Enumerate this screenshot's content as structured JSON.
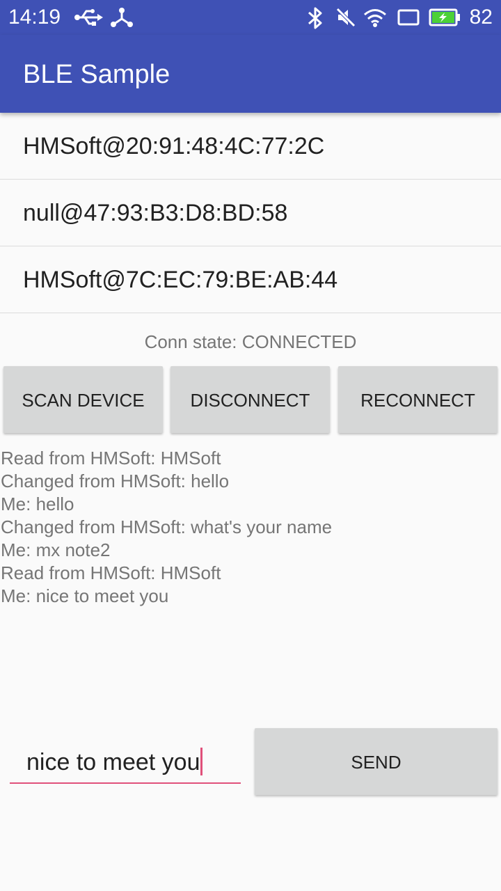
{
  "status_bar": {
    "time": "14:19",
    "battery_percent": "82",
    "icons": [
      "usb-icon",
      "share-icon",
      "bluetooth-icon",
      "mute-icon",
      "wifi-icon",
      "screen-icon",
      "battery-icon"
    ]
  },
  "app_bar": {
    "title": "BLE Sample"
  },
  "devices": [
    "HMSoft@20:91:48:4C:77:2C",
    "null@47:93:B3:D8:BD:58",
    "HMSoft@7C:EC:79:BE:AB:44"
  ],
  "conn_state": "Conn state: CONNECTED",
  "buttons": {
    "scan": "SCAN DEVICE",
    "disconnect": "DISCONNECT",
    "reconnect": "RECONNECT",
    "send": "SEND"
  },
  "log": [
    "Read from HMSoft: HMSoft",
    "Changed from HMSoft: hello",
    "Me: hello",
    "Changed from HMSoft: what's your name",
    "Me: mx note2",
    "Read from HMSoft: HMSoft",
    "Me: nice to meet you"
  ],
  "message_input": {
    "value": "nice to meet you"
  },
  "colors": {
    "primary": "#3f51b5",
    "accent": "#e0507a",
    "button": "#d6d7d7",
    "battery_fill": "#4cd137"
  }
}
